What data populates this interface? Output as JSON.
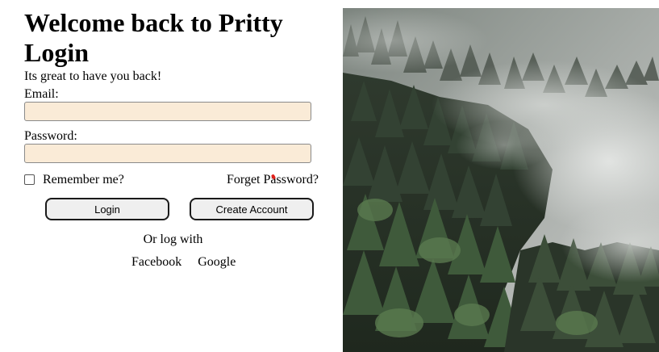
{
  "header": {
    "title": "Welcome back to Pritty Login",
    "subtitle": "Its great to have you back!"
  },
  "form": {
    "email_label": "Email:",
    "email_value": "",
    "password_label": "Password:",
    "password_value": "",
    "remember_label": "Remember me?",
    "remember_checked": false,
    "forget_password_label": "Forget Password?",
    "login_button": "Login",
    "create_account_button": "Create Account"
  },
  "social": {
    "prompt": "Or log with",
    "providers": [
      "Facebook",
      "Google"
    ]
  },
  "colors": {
    "input_background": "#faebd7",
    "button_background": "#efefef",
    "cursor_accent": "#e0201a"
  },
  "hero": {
    "subject": "misty pine forest photograph"
  }
}
